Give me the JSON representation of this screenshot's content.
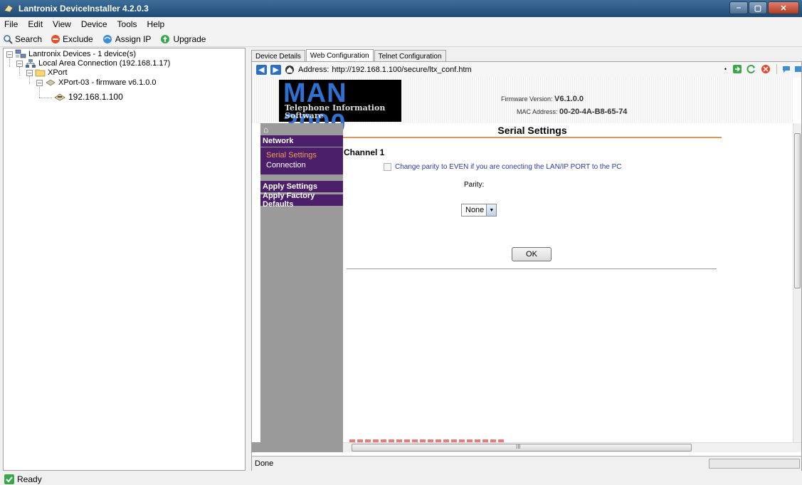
{
  "window": {
    "title": "Lantronix DeviceInstaller 4.2.0.3"
  },
  "menu": [
    "File",
    "Edit",
    "View",
    "Device",
    "Tools",
    "Help"
  ],
  "toolbar": {
    "search": "Search",
    "exclude": "Exclude",
    "assign_ip": "Assign IP",
    "upgrade": "Upgrade"
  },
  "tree": {
    "root": "Lantronix Devices - 1 device(s)",
    "connection": "Local Area Connection (192.168.1.17)",
    "group": "XPort",
    "device": "XPort-03 - firmware v6.1.0.0",
    "ip": "192.168.1.100"
  },
  "tabs": [
    "Device Details",
    "Web Configuration",
    "Telnet Configuration"
  ],
  "browser": {
    "address_label": "Address:",
    "url": "http://192.168.1.100/secure/ltx_conf.htm",
    "status": "Done"
  },
  "page": {
    "logo_title": "MAN 3000",
    "logo_subtitle_1": "Telephone Information",
    "logo_subtitle_2": "Software",
    "firmware_label": "Firmware Version:",
    "firmware_value": "V6.1.0.0",
    "mac_label": "MAC Address:",
    "mac_value": "00-20-4A-B8-65-74",
    "section_title": "Serial Settings",
    "channel": "Channel 1",
    "parity_checkbox_label": "Change parity to EVEN if you are conecting the LAN/IP PORT to the PC",
    "parity_label": "Parity:",
    "parity_value": "None",
    "ok_label": "OK",
    "sidebar": {
      "network": "Network",
      "serial_settings": "Serial Settings",
      "connection": "Connection",
      "apply_settings": "Apply Settings",
      "apply_factory_defaults": "Apply Factory Defaults"
    }
  },
  "hscroll_glyph": "III",
  "app_status": "Ready",
  "colors": {
    "menu_purple": "#4b1f6a",
    "accent_orange": "#d99b55",
    "logo_blue": "#3070d0",
    "serial_link": "#f0a050"
  }
}
